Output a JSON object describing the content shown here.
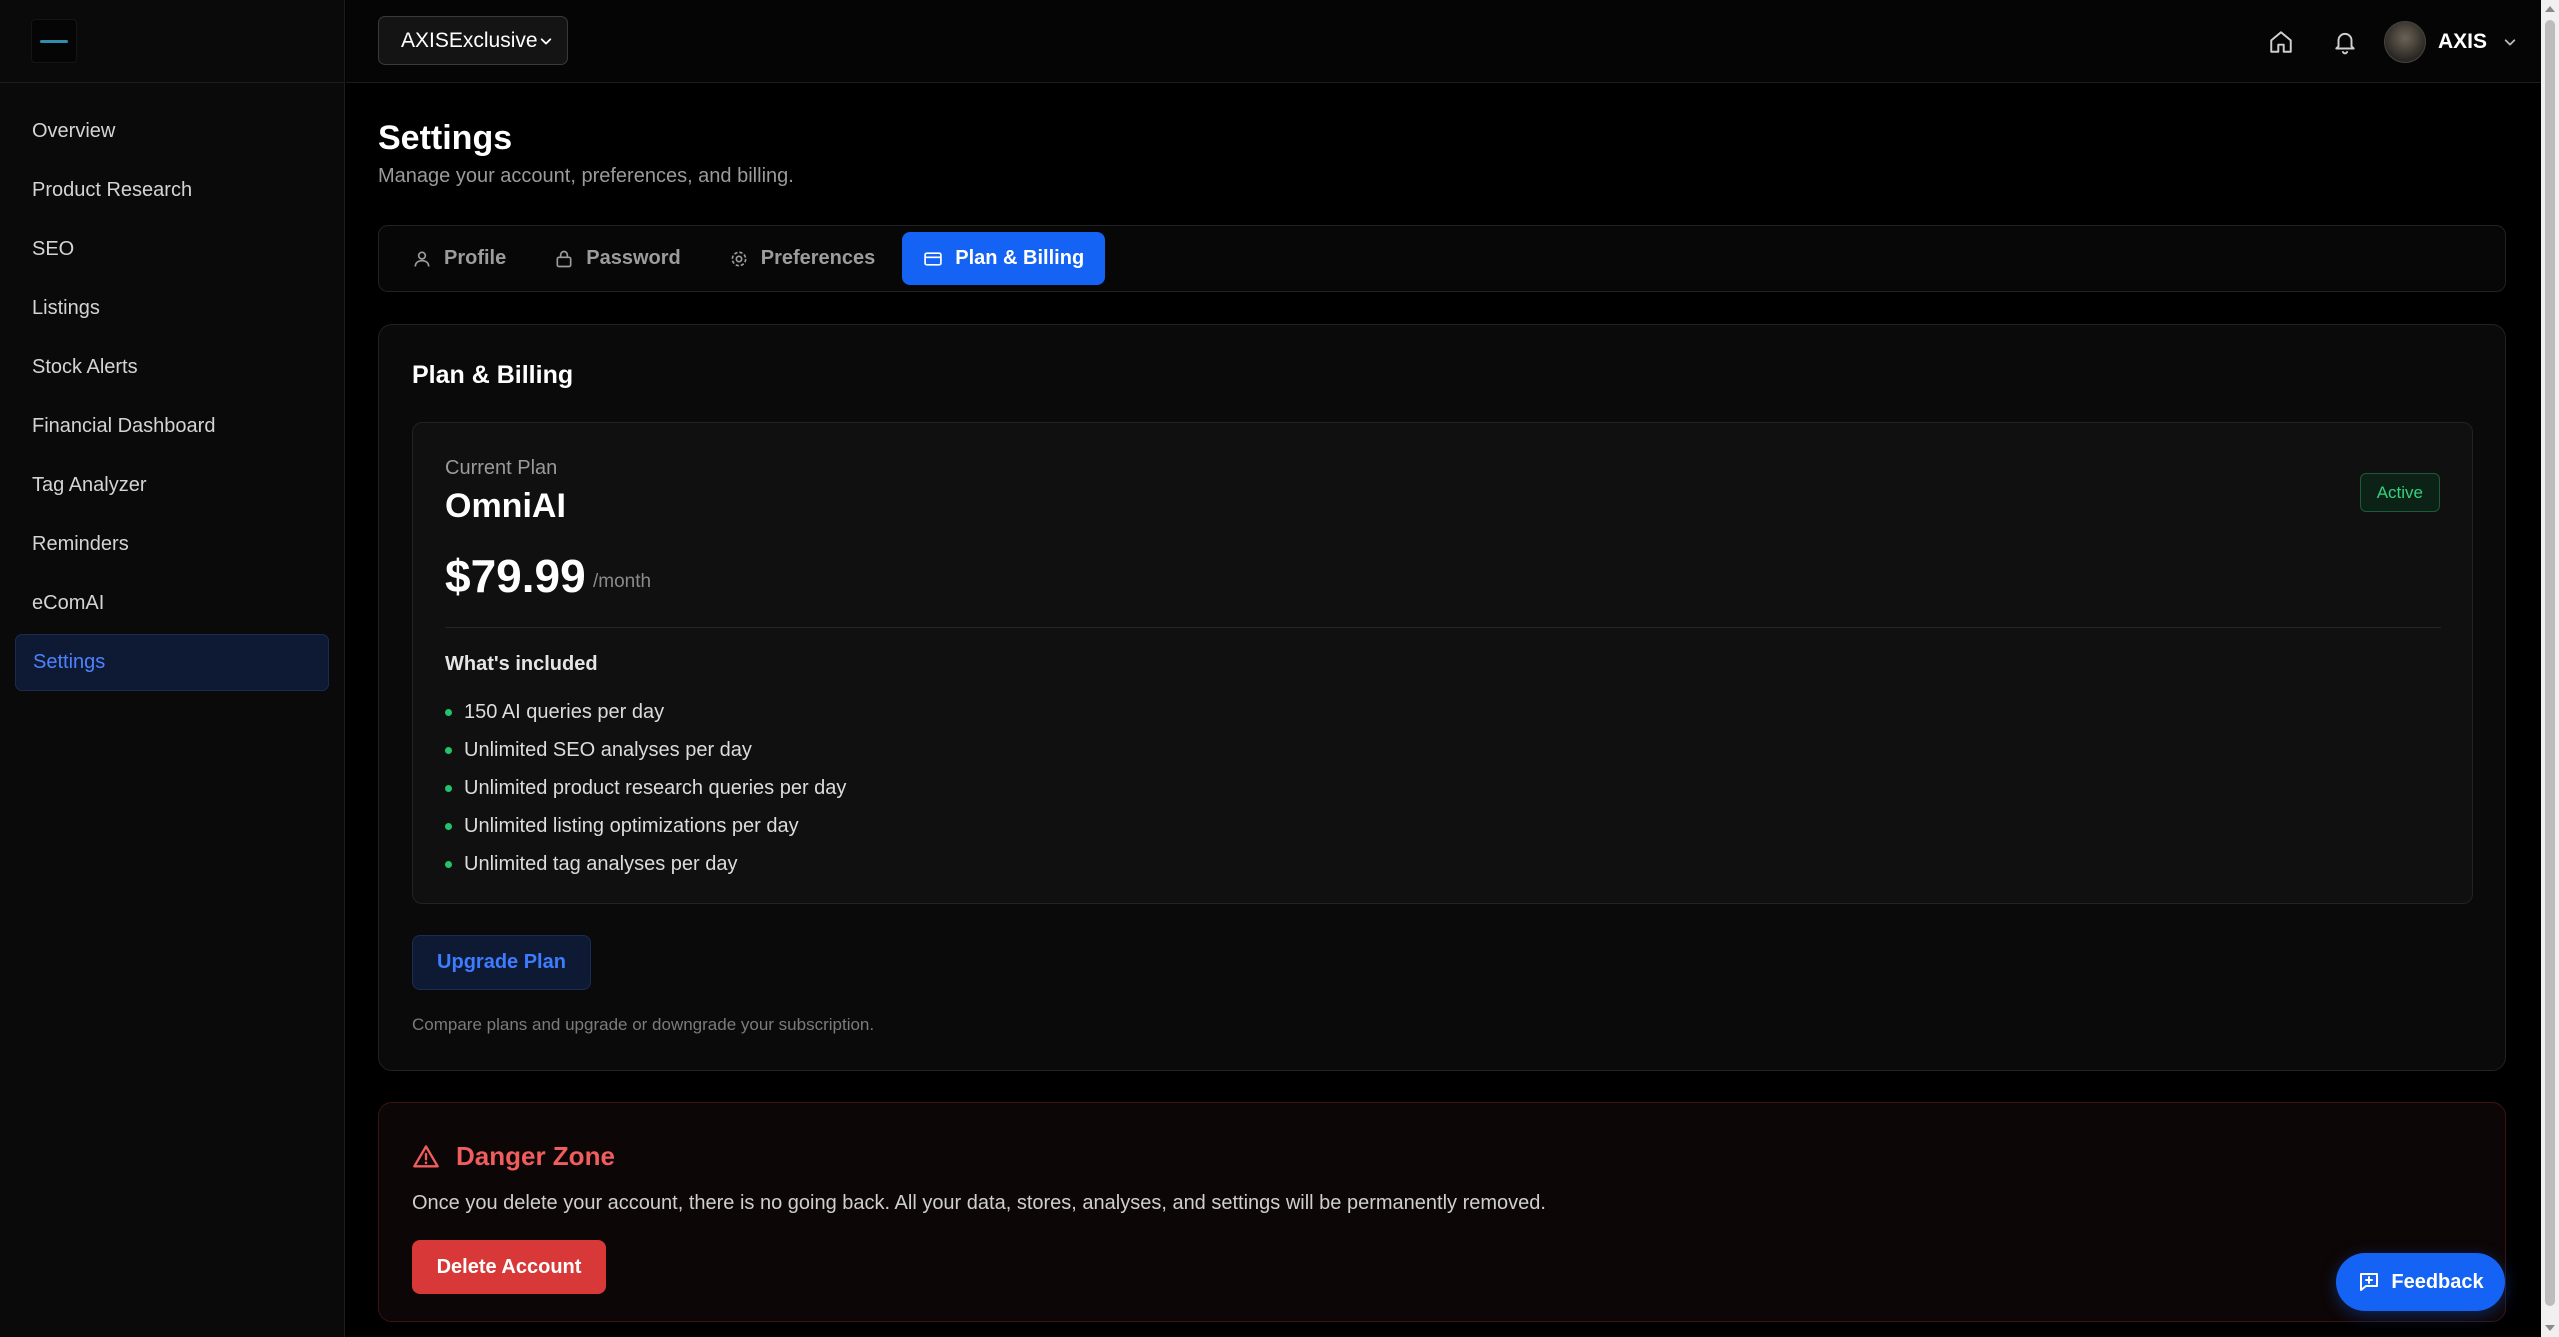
{
  "sidebar": {
    "items": [
      {
        "label": "Overview"
      },
      {
        "label": "Product Research"
      },
      {
        "label": "SEO"
      },
      {
        "label": "Listings"
      },
      {
        "label": "Stock Alerts"
      },
      {
        "label": "Financial Dashboard"
      },
      {
        "label": "Tag Analyzer"
      },
      {
        "label": "Reminders"
      },
      {
        "label": "eComAI"
      },
      {
        "label": "Settings",
        "active": true
      }
    ]
  },
  "topbar": {
    "store_select": "AXISExclusive",
    "user_name": "AXIS",
    "icons": [
      "home-icon",
      "bell-icon",
      "chevron-down-icon"
    ]
  },
  "page": {
    "title": "Settings",
    "subtitle": "Manage your account, preferences, and billing."
  },
  "tabs": [
    {
      "label": "Profile",
      "icon": "user-icon"
    },
    {
      "label": "Password",
      "icon": "lock-icon"
    },
    {
      "label": "Preferences",
      "icon": "gear-icon"
    },
    {
      "label": "Plan & Billing",
      "icon": "credit-card-icon",
      "active": true
    }
  ],
  "billing": {
    "card_title": "Plan & Billing",
    "current_plan_label": "Current Plan",
    "plan_name": "OmniAI",
    "price": "$79.99",
    "period": "/month",
    "status": "Active",
    "included_title": "What's included",
    "features": [
      "150 AI queries per day",
      "Unlimited SEO analyses per day",
      "Unlimited product research queries per day",
      "Unlimited listing optimizations per day",
      "Unlimited tag analyses per day"
    ],
    "upgrade_label": "Upgrade Plan",
    "upgrade_note": "Compare plans and upgrade or downgrade your subscription."
  },
  "danger": {
    "title": "Danger Zone",
    "text": "Once you delete your account, there is no going back. All your data, stores, analyses, and settings will be permanently removed.",
    "delete_label": "Delete Account"
  },
  "feedback": {
    "label": "Feedback"
  },
  "colors": {
    "accent": "#1463f5",
    "active_badge": "#34d27f",
    "danger": "#ef5d5d",
    "delete_button": "#d93838"
  }
}
